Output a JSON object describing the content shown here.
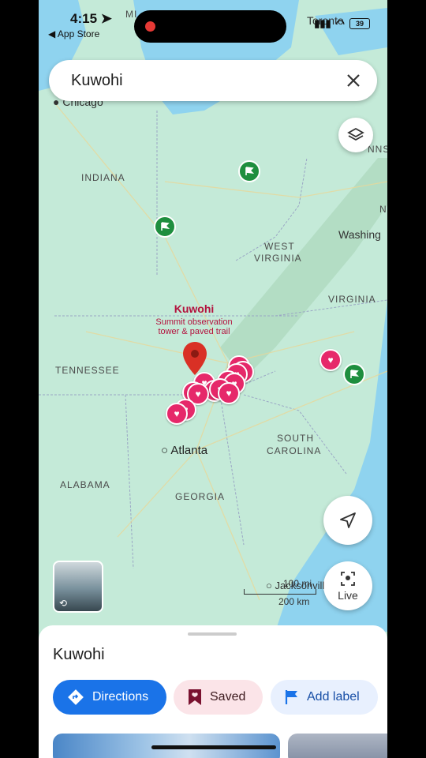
{
  "status": {
    "time": "4:15",
    "back_label": "◀ App Store",
    "battery": "39"
  },
  "search": {
    "query": "Kuwohi"
  },
  "map": {
    "cities": {
      "chicago": "Chicago",
      "atlanta": "Atlanta",
      "toronto": "Toronto",
      "washington": "Washing",
      "jacksonville": "Jacksonvill"
    },
    "states": {
      "indiana": "INDIANA",
      "west_virginia_1": "WEST",
      "west_virginia_2": "VIRGINIA",
      "virginia": "VIRGINIA",
      "tennessee": "TENNESSEE",
      "south_carolina_1": "SOUTH",
      "south_carolina_2": "CAROLINA",
      "georgia": "GEORGIA",
      "alabama": "ALABAMA",
      "pennsylvania_fragment": "NNSY",
      "mi_fragment": "MI",
      "n_fragment": "N"
    },
    "poi": {
      "name": "Kuwohi",
      "desc_line1": "Summit observation",
      "desc_line2": "tower & paved trail"
    },
    "scale": {
      "miles": "100 mi",
      "km": "200 km"
    }
  },
  "controls": {
    "live_label": "Live"
  },
  "sheet": {
    "title": "Kuwohi",
    "directions": "Directions",
    "saved": "Saved",
    "add_label": "Add label"
  },
  "colors": {
    "accent": "#1a73e8",
    "heart": "#e6286a",
    "flag": "#1e8e3e",
    "poi_text": "#b3123e",
    "water": "#8fd3ef",
    "land": "#bfe8d6"
  }
}
